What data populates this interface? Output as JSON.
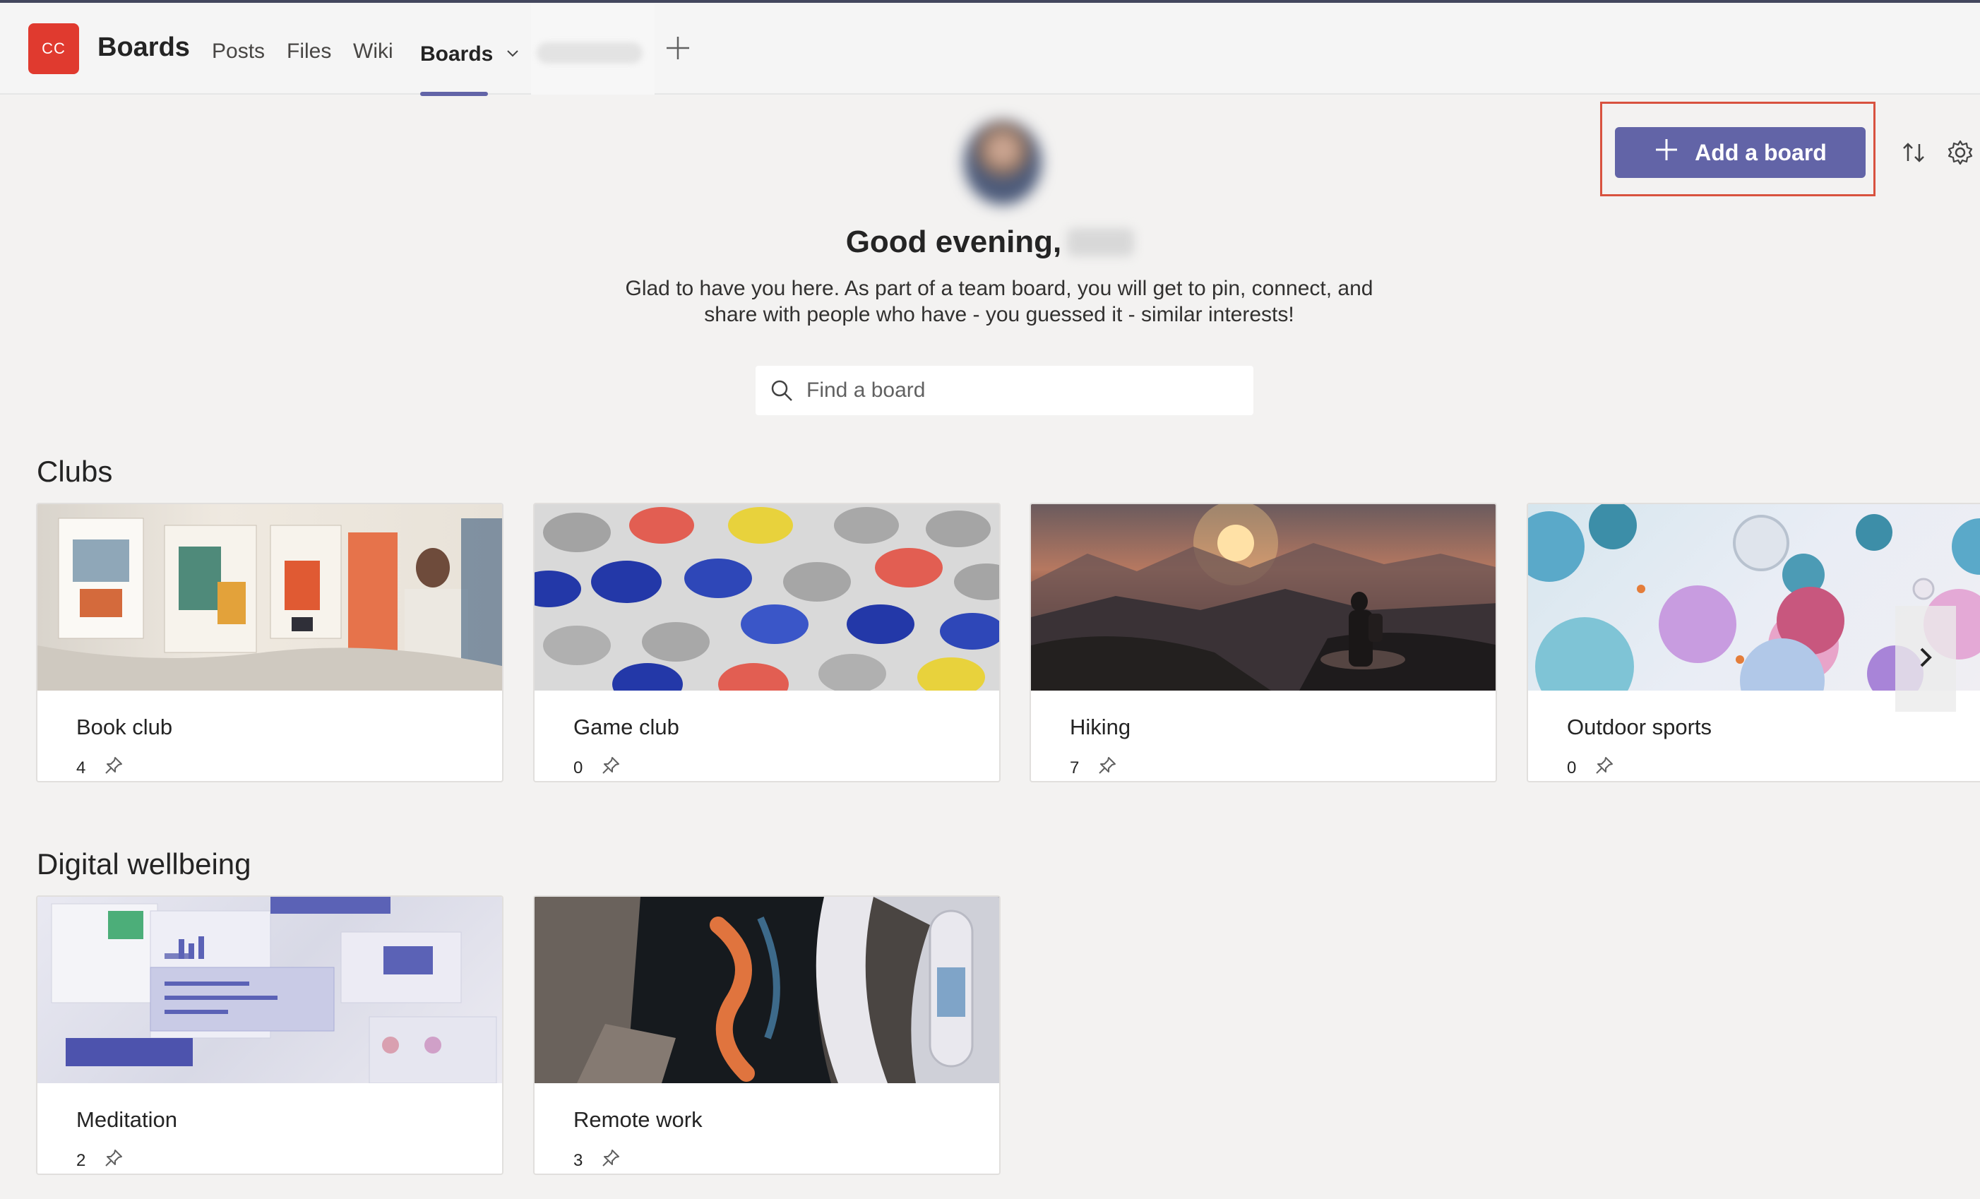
{
  "topbar": {
    "team_initials": "CC",
    "app_title": "Boards",
    "tabs": [
      {
        "label": "Posts"
      },
      {
        "label": "Files"
      },
      {
        "label": "Wiki"
      },
      {
        "label": "Boards",
        "active": true
      }
    ]
  },
  "header": {
    "add_board_label": "Add a board",
    "greeting": "Good evening,",
    "intro_text": "Glad to have you here. As part of a team board, you will get to pin, connect, and share with people who have - you guessed it - similar interests!",
    "search_placeholder": "Find a board"
  },
  "sections": [
    {
      "title": "Clubs",
      "cards": [
        {
          "name": "Book club",
          "pins": "4"
        },
        {
          "name": "Game club",
          "pins": "0"
        },
        {
          "name": "Hiking",
          "pins": "7"
        },
        {
          "name": "Outdoor sports",
          "pins": "0"
        }
      ]
    },
    {
      "title": "Digital wellbeing",
      "cards": [
        {
          "name": "Meditation",
          "pins": "2"
        },
        {
          "name": "Remote work",
          "pins": "3"
        }
      ]
    }
  ],
  "icons": {
    "add": "plus-icon",
    "sort": "sort-icon",
    "settings": "gear-icon",
    "search": "search-icon",
    "pin": "pin-icon",
    "next": "chevron-right-icon"
  },
  "colors": {
    "accent": "#6264a7",
    "team_avatar": "#e03a2f",
    "highlight_outline": "#d8523f"
  }
}
